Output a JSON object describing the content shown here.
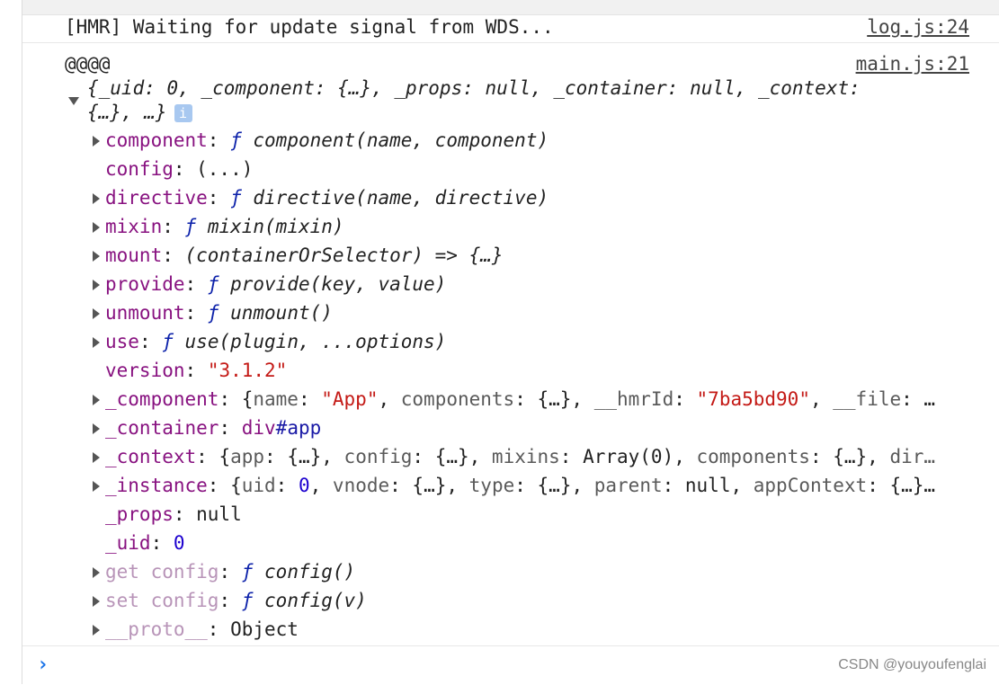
{
  "log1": {
    "text": "[HMR] Waiting for update signal from WDS...",
    "source": "log.js:24"
  },
  "log2": {
    "text": "@@@@",
    "source": "main.js:21"
  },
  "summary": {
    "line1": "{_uid: 0, _component: {…}, _props: null, _container: null, _context:",
    "line2": "{…}, …}",
    "info_icon": "i"
  },
  "rows": [
    {
      "expandable": true,
      "seg": [
        [
          "k",
          "component"
        ],
        [
          "b",
          ": "
        ],
        [
          "f",
          "ƒ "
        ],
        [
          "it",
          "component(name, component)"
        ]
      ]
    },
    {
      "expandable": false,
      "seg": [
        [
          "k",
          "config"
        ],
        [
          "b",
          ": (...)"
        ]
      ]
    },
    {
      "expandable": true,
      "seg": [
        [
          "k",
          "directive"
        ],
        [
          "b",
          ": "
        ],
        [
          "f",
          "ƒ "
        ],
        [
          "it",
          "directive(name, directive)"
        ]
      ]
    },
    {
      "expandable": true,
      "seg": [
        [
          "k",
          "mixin"
        ],
        [
          "b",
          ": "
        ],
        [
          "f",
          "ƒ "
        ],
        [
          "it",
          "mixin(mixin)"
        ]
      ]
    },
    {
      "expandable": true,
      "seg": [
        [
          "k",
          "mount"
        ],
        [
          "b",
          ": "
        ],
        [
          "it",
          "(containerOrSelector) => {…}"
        ]
      ]
    },
    {
      "expandable": true,
      "seg": [
        [
          "k",
          "provide"
        ],
        [
          "b",
          ": "
        ],
        [
          "f",
          "ƒ "
        ],
        [
          "it",
          "provide(key, value)"
        ]
      ]
    },
    {
      "expandable": true,
      "seg": [
        [
          "k",
          "unmount"
        ],
        [
          "b",
          ": "
        ],
        [
          "f",
          "ƒ "
        ],
        [
          "it",
          "unmount()"
        ]
      ]
    },
    {
      "expandable": true,
      "seg": [
        [
          "k",
          "use"
        ],
        [
          "b",
          ": "
        ],
        [
          "f",
          "ƒ "
        ],
        [
          "it",
          "use(plugin, ...options)"
        ]
      ]
    },
    {
      "expandable": false,
      "seg": [
        [
          "k",
          "version"
        ],
        [
          "b",
          ": "
        ],
        [
          "s",
          "\"3.1.2\""
        ]
      ]
    },
    {
      "expandable": true,
      "seg": [
        [
          "k",
          "_component"
        ],
        [
          "b",
          ": {"
        ],
        [
          "p",
          "name"
        ],
        [
          "b",
          ": "
        ],
        [
          "s",
          "\"App\""
        ],
        [
          "b",
          ", "
        ],
        [
          "p",
          "components"
        ],
        [
          "b",
          ": {…}, "
        ],
        [
          "p",
          "__hmrId"
        ],
        [
          "b",
          ": "
        ],
        [
          "s",
          "\"7ba5bd90\""
        ],
        [
          "b",
          ", "
        ],
        [
          "p",
          "__file"
        ],
        [
          "b",
          ": …"
        ]
      ]
    },
    {
      "expandable": true,
      "seg": [
        [
          "k",
          "_container"
        ],
        [
          "b",
          ": "
        ],
        [
          "tag",
          "div"
        ],
        [
          "id",
          "#app"
        ]
      ]
    },
    {
      "expandable": true,
      "seg": [
        [
          "k",
          "_context"
        ],
        [
          "b",
          ": {"
        ],
        [
          "p",
          "app"
        ],
        [
          "b",
          ": {…}, "
        ],
        [
          "p",
          "config"
        ],
        [
          "b",
          ": {…}, "
        ],
        [
          "p",
          "mixins"
        ],
        [
          "b",
          ": Array(0), "
        ],
        [
          "p",
          "components"
        ],
        [
          "b",
          ": {…}, "
        ],
        [
          "p",
          "dir…"
        ]
      ]
    },
    {
      "expandable": true,
      "seg": [
        [
          "k",
          "_instance"
        ],
        [
          "b",
          ": {"
        ],
        [
          "p",
          "uid"
        ],
        [
          "b",
          ": "
        ],
        [
          "n",
          "0"
        ],
        [
          "b",
          ", "
        ],
        [
          "p",
          "vnode"
        ],
        [
          "b",
          ": {…}, "
        ],
        [
          "p",
          "type"
        ],
        [
          "b",
          ": {…}, "
        ],
        [
          "p",
          "parent"
        ],
        [
          "b",
          ": null, "
        ],
        [
          "p",
          "appContext"
        ],
        [
          "b",
          ": {…}…"
        ]
      ]
    },
    {
      "expandable": false,
      "seg": [
        [
          "k",
          "_props"
        ],
        [
          "b",
          ": null"
        ]
      ]
    },
    {
      "expandable": false,
      "seg": [
        [
          "k",
          "_uid"
        ],
        [
          "b",
          ": "
        ],
        [
          "n",
          "0"
        ]
      ]
    },
    {
      "expandable": true,
      "seg": [
        [
          "kd",
          "get config"
        ],
        [
          "b",
          ": "
        ],
        [
          "f",
          "ƒ "
        ],
        [
          "it",
          "config()"
        ]
      ]
    },
    {
      "expandable": true,
      "seg": [
        [
          "kd",
          "set config"
        ],
        [
          "b",
          ": "
        ],
        [
          "f",
          "ƒ "
        ],
        [
          "it",
          "config(v)"
        ]
      ]
    },
    {
      "expandable": true,
      "seg": [
        [
          "kd",
          "__proto__"
        ],
        [
          "b",
          ": Object"
        ]
      ]
    }
  ],
  "prompt_icon": "chevron-right",
  "watermark": "CSDN @youyoufenglai"
}
